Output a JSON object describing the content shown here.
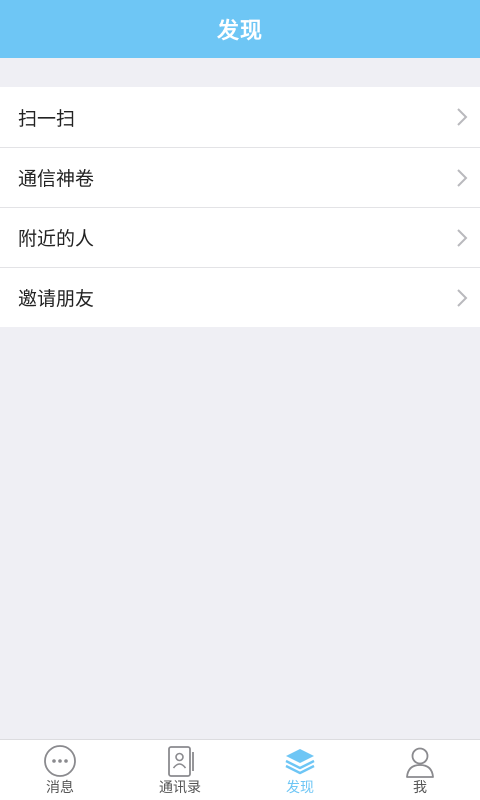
{
  "header": {
    "title": "发现"
  },
  "menu": {
    "items": [
      {
        "label": "扫一扫",
        "icon": "chevron-right-icon"
      },
      {
        "label": "通信神卷",
        "icon": "chevron-right-icon"
      },
      {
        "label": "附近的人",
        "icon": "chevron-right-icon"
      },
      {
        "label": "邀请朋友",
        "icon": "chevron-right-icon"
      }
    ]
  },
  "tabbar": {
    "tabs": [
      {
        "label": "消息",
        "icon": "chat-bubble-icon",
        "active": false
      },
      {
        "label": "通讯录",
        "icon": "contacts-book-icon",
        "active": false
      },
      {
        "label": "发现",
        "icon": "layers-icon",
        "active": true
      },
      {
        "label": "我",
        "icon": "person-icon",
        "active": false
      }
    ]
  },
  "colors": {
    "accent": "#6ec6f5",
    "background": "#efeff4",
    "surface": "#ffffff",
    "text": "#222222",
    "muted": "#555555"
  }
}
